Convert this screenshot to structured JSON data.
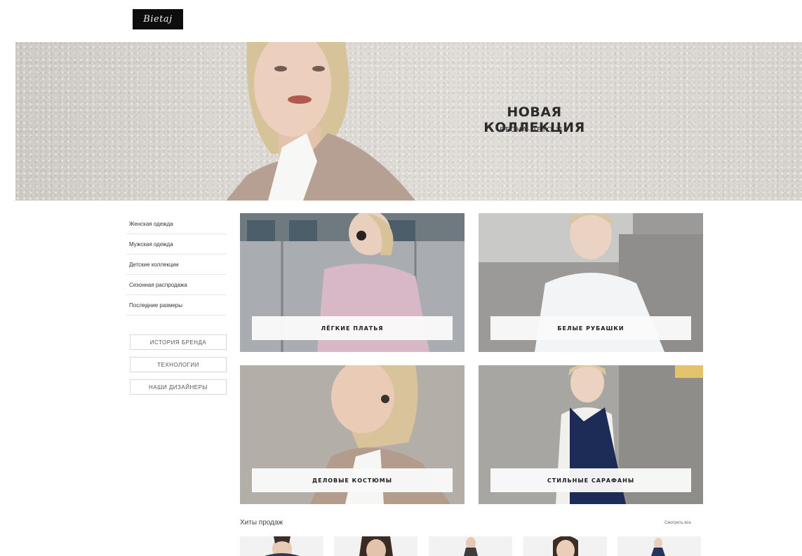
{
  "brand": {
    "logo_text": "Bietaj"
  },
  "hero": {
    "title": "НОВАЯ КОЛЛЕКЦИЯ",
    "subtitle": "ВЕСНА-ЛЕТО '19"
  },
  "sidebar": {
    "items": [
      {
        "label": "Женская одежда"
      },
      {
        "label": "Мужская одежда"
      },
      {
        "label": "Детские коллекции"
      },
      {
        "label": "Сезонная распродажа"
      },
      {
        "label": "Последние размеры"
      }
    ],
    "buttons": [
      {
        "label": "ИСТОРИЯ БРЕНДА"
      },
      {
        "label": "ТЕХНОЛОГИИ"
      },
      {
        "label": "НАШИ ДИЗАЙНЕРЫ"
      }
    ]
  },
  "categories": [
    {
      "label": "ЛЁГКИЕ ПЛАТЬЯ"
    },
    {
      "label": "БЕЛЫЕ РУБАШКИ"
    },
    {
      "label": "ДЕЛОВЫЕ КОСТЮМЫ"
    },
    {
      "label": "СТИЛЬНЫЕ САРАФАНЫ"
    }
  ],
  "bestsellers": {
    "title": "Хиты продаж",
    "see_all": "Смотреть все",
    "count_visible": 5
  },
  "colors": {
    "logo_bg": "#0d0d0d",
    "text": "#222222",
    "label_bg": "#fafafa"
  }
}
